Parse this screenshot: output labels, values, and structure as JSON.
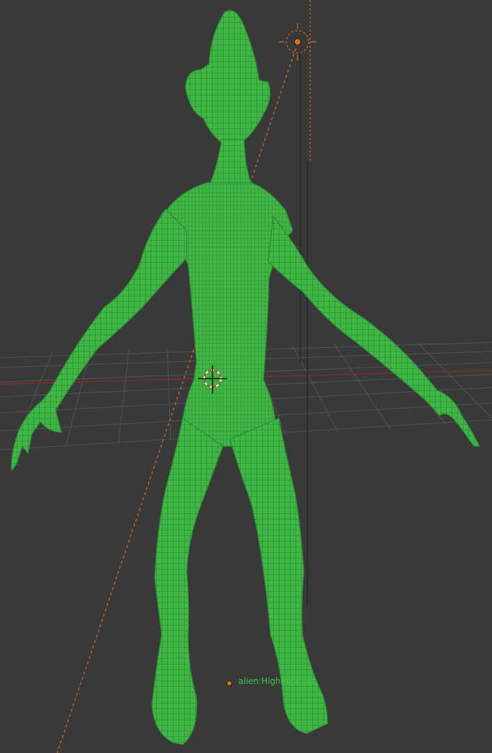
{
  "viewport": {
    "object_label": "alien:HighResEyes",
    "colors": {
      "background": "#393939",
      "grid": "#525252",
      "x_axis": "#8a2b2b",
      "wire": "#35b03f",
      "wire_line": "#2c8734",
      "light": "#f06a1e",
      "label_text": "#3ec74a"
    }
  },
  "icons": {
    "light": "sun-lamp-icon",
    "cursor": "3d-cursor-icon",
    "origin": "object-origin-icon"
  }
}
